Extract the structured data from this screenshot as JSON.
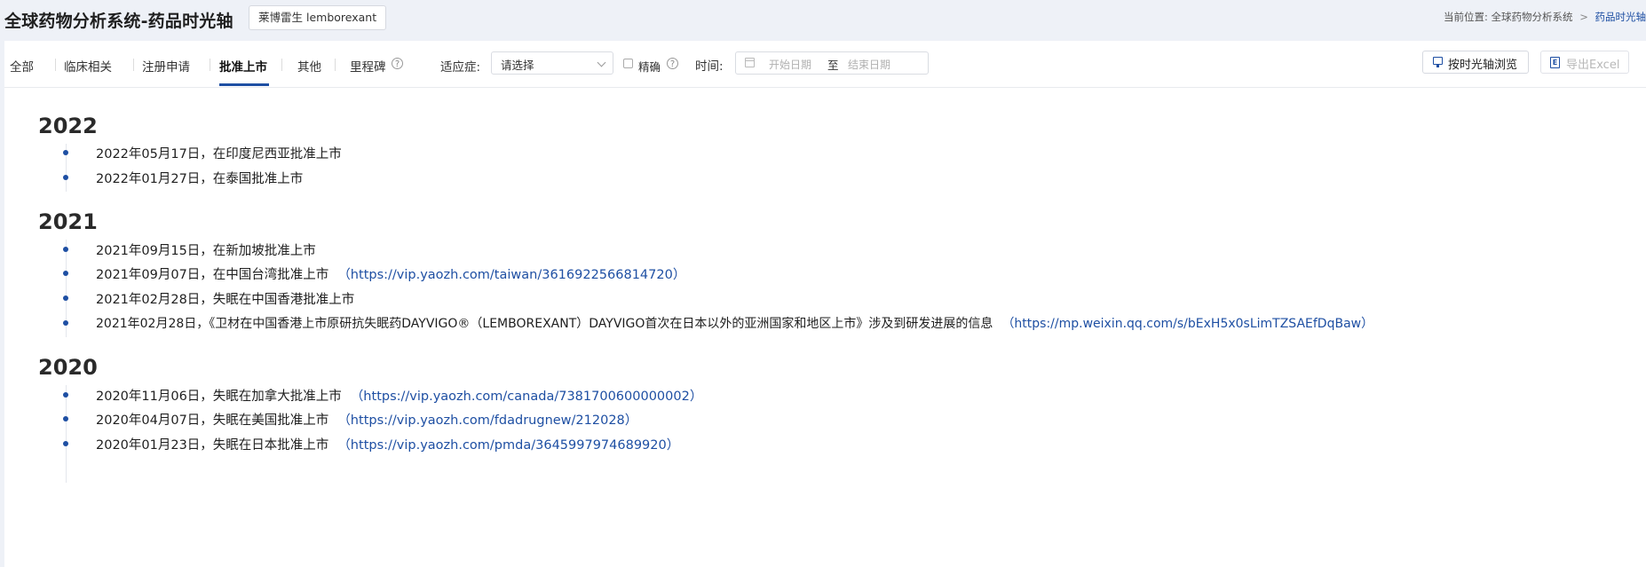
{
  "header": {
    "title": "全球药物分析系统-药品时光轴",
    "drug_chip": "莱博雷生 lemborexant",
    "breadcrumb": {
      "prefix": "当前位置:",
      "parent": "全球药物分析系统",
      "separator": ">",
      "current": "药品时光轴"
    }
  },
  "toolbar": {
    "tabs": [
      {
        "label": "全部",
        "active": false
      },
      {
        "label": "临床相关",
        "active": false
      },
      {
        "label": "注册申请",
        "active": false
      },
      {
        "label": "批准上市",
        "active": true
      },
      {
        "label": "其他",
        "active": false
      },
      {
        "label": "里程碑",
        "active": false
      }
    ],
    "indication_label": "适应症:",
    "indication_value": "请选择",
    "exact_label": "精确",
    "time_label": "时间:",
    "date_start_placeholder": "开始日期",
    "date_to": "至",
    "date_end_placeholder": "结束日期",
    "browse_button": "按时光轴浏览",
    "export_button": "导出Excel"
  },
  "timeline": [
    {
      "year": "2022",
      "events": [
        {
          "text": "2022年05月17日，在印度尼西亚批准上市",
          "link": ""
        },
        {
          "text": "2022年01月27日，在泰国批准上市",
          "link": ""
        }
      ]
    },
    {
      "year": "2021",
      "events": [
        {
          "text": "2021年09月15日，在新加坡批准上市",
          "link": ""
        },
        {
          "text": "2021年09月07日，在中国台湾批准上市",
          "link": "（https://vip.yaozh.com/taiwan/3616922566814720）"
        },
        {
          "text": "2021年02月28日，失眠在中国香港批准上市",
          "link": ""
        },
        {
          "text": "2021年02月28日，《卫材在中国香港上市原研抗失眠药DAYVIGO®（LEMBOREXANT）DAYVIGO首次在日本以外的亚洲国家和地区上市》涉及到研发进展的信息",
          "link": "（https://mp.weixin.qq.com/s/bExH5x0sLimTZSAEfDqBaw）"
        }
      ]
    },
    {
      "year": "2020",
      "events": [
        {
          "text": "2020年11月06日，失眠在加拿大批准上市",
          "link": "（https://vip.yaozh.com/canada/7381700600000002）"
        },
        {
          "text": "2020年04月07日，失眠在美国批准上市",
          "link": "（https://vip.yaozh.com/fdadrugnew/212028）"
        },
        {
          "text": "2020年01月23日，失眠在日本批准上市",
          "link": "（https://vip.yaozh.com/pmda/3645997974689920）"
        }
      ]
    }
  ],
  "colors": {
    "accent": "#1e4fa3",
    "page_bg": "#eef1f7"
  }
}
